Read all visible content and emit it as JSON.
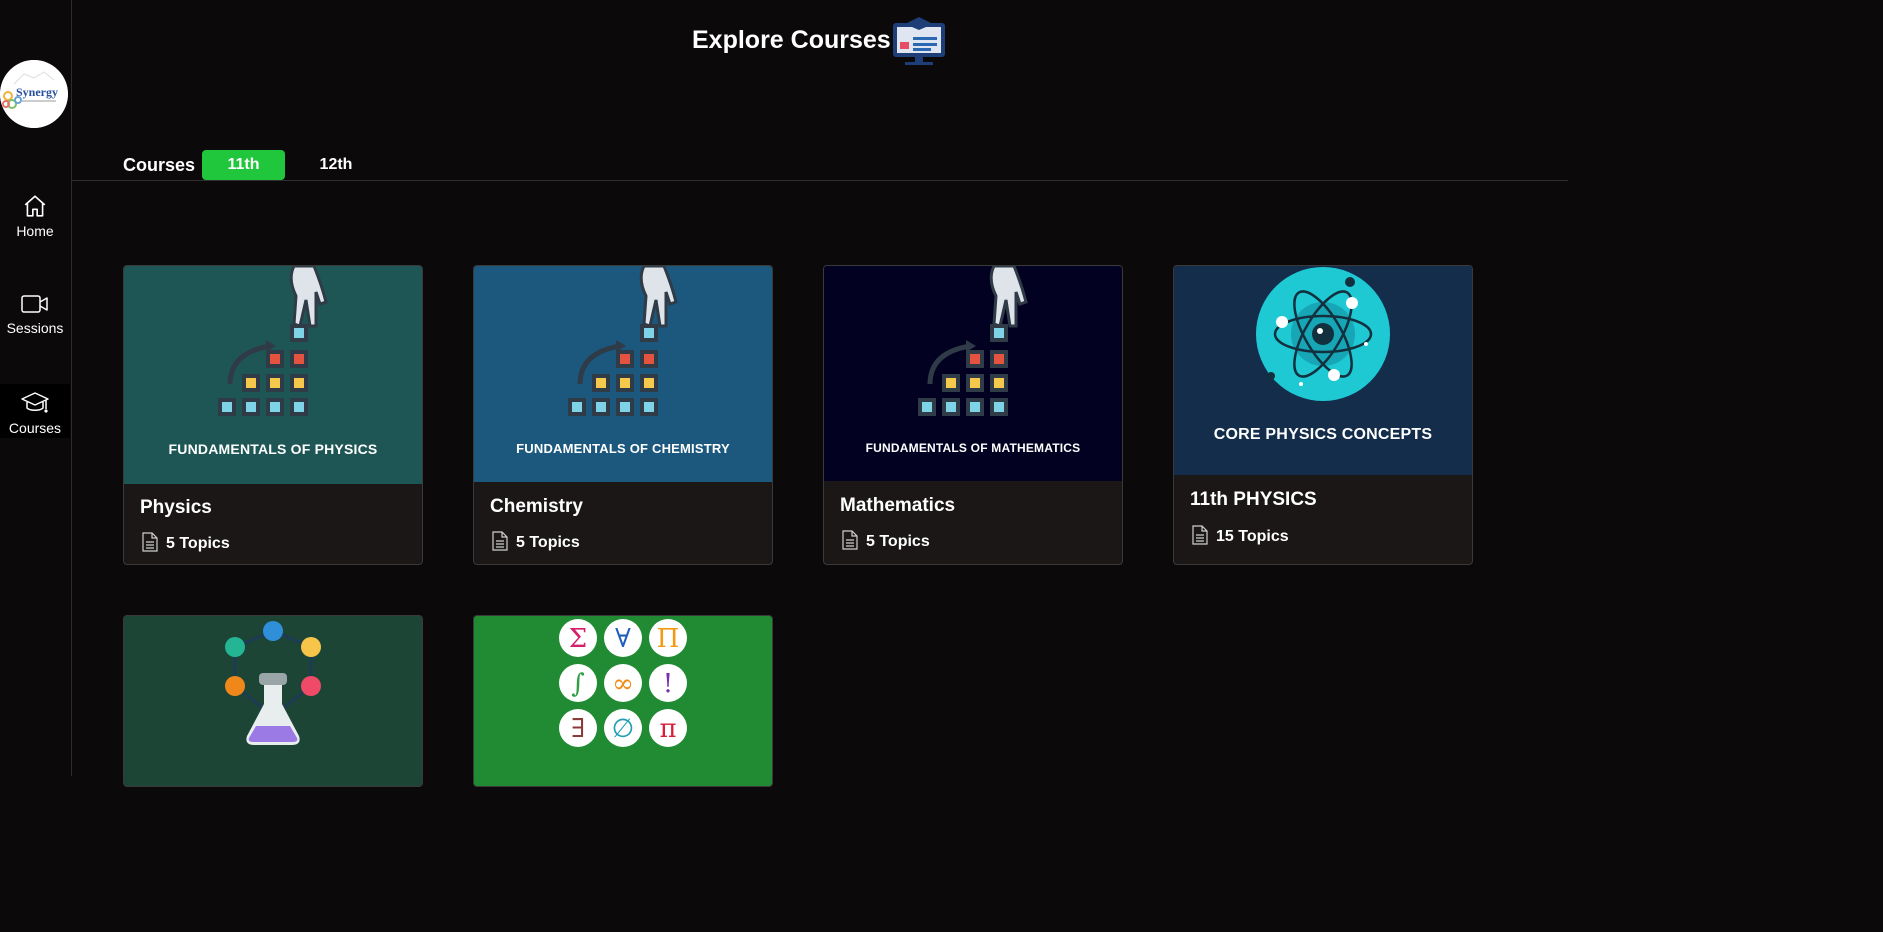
{
  "app": {
    "logo_text": "Synergy"
  },
  "sidebar": {
    "items": [
      {
        "label": "Home",
        "icon": "home-icon"
      },
      {
        "label": "Sessions",
        "icon": "video-icon"
      },
      {
        "label": "Courses",
        "icon": "graduation-cap-icon",
        "active": true
      }
    ]
  },
  "header": {
    "title": "Explore Courses",
    "icon": "course-monitor-icon"
  },
  "tabs": {
    "label": "Courses",
    "items": [
      {
        "label": "11th",
        "active": true
      },
      {
        "label": "12th",
        "active": false
      }
    ]
  },
  "courses": [
    {
      "title": "Physics",
      "topics": "5 Topics",
      "banner": "FUNDAMENTALS OF PHYSICS",
      "bg": "#1e5656"
    },
    {
      "title": "Chemistry",
      "topics": "5 Topics",
      "banner": "FUNDAMENTALS OF CHEMISTRY",
      "bg": "#1c587e"
    },
    {
      "title": "Mathematics",
      "topics": "5 Topics",
      "banner": "FUNDAMENTALS OF MATHEMATICS",
      "bg": "#020121"
    },
    {
      "title": "11th PHYSICS",
      "topics": "15 Topics",
      "banner": "CORE PHYSICS CONCEPTS",
      "bg": "#132d4b"
    },
    {
      "title": "",
      "topics": "",
      "banner": "",
      "bg": "#1c4535"
    },
    {
      "title": "",
      "topics": "",
      "banner": "",
      "bg": "#218b34"
    }
  ],
  "math_symbols": [
    "Σ",
    "∀",
    "Π",
    "∫",
    "∞",
    "!",
    "∃",
    "∅",
    "π"
  ],
  "colors": {
    "accent": "#20c63b",
    "background": "#0b0909",
    "card": "#1a1716"
  }
}
